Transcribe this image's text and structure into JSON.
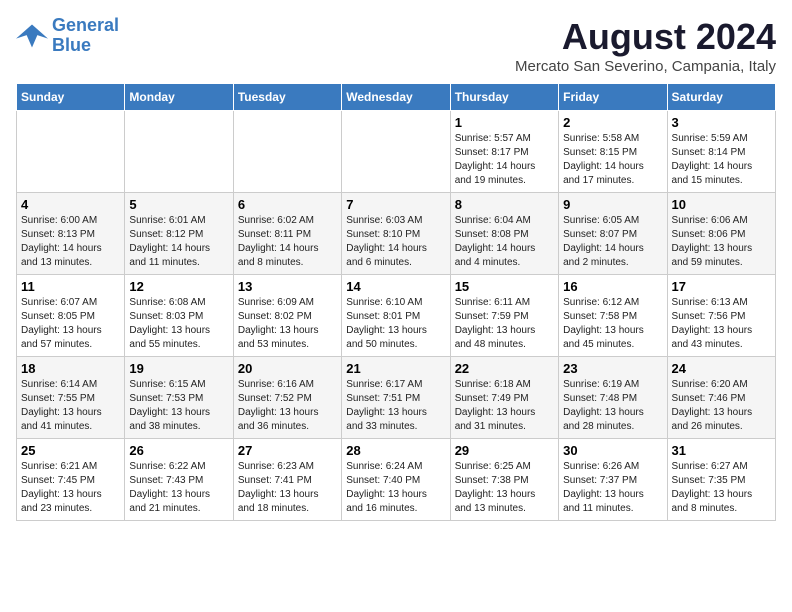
{
  "logo": {
    "line1": "General",
    "line2": "Blue"
  },
  "title": "August 2024",
  "subtitle": "Mercato San Severino, Campania, Italy",
  "weekdays": [
    "Sunday",
    "Monday",
    "Tuesday",
    "Wednesday",
    "Thursday",
    "Friday",
    "Saturday"
  ],
  "weeks": [
    [
      {
        "day": "",
        "info": ""
      },
      {
        "day": "",
        "info": ""
      },
      {
        "day": "",
        "info": ""
      },
      {
        "day": "",
        "info": ""
      },
      {
        "day": "1",
        "info": "Sunrise: 5:57 AM\nSunset: 8:17 PM\nDaylight: 14 hours\nand 19 minutes."
      },
      {
        "day": "2",
        "info": "Sunrise: 5:58 AM\nSunset: 8:15 PM\nDaylight: 14 hours\nand 17 minutes."
      },
      {
        "day": "3",
        "info": "Sunrise: 5:59 AM\nSunset: 8:14 PM\nDaylight: 14 hours\nand 15 minutes."
      }
    ],
    [
      {
        "day": "4",
        "info": "Sunrise: 6:00 AM\nSunset: 8:13 PM\nDaylight: 14 hours\nand 13 minutes."
      },
      {
        "day": "5",
        "info": "Sunrise: 6:01 AM\nSunset: 8:12 PM\nDaylight: 14 hours\nand 11 minutes."
      },
      {
        "day": "6",
        "info": "Sunrise: 6:02 AM\nSunset: 8:11 PM\nDaylight: 14 hours\nand 8 minutes."
      },
      {
        "day": "7",
        "info": "Sunrise: 6:03 AM\nSunset: 8:10 PM\nDaylight: 14 hours\nand 6 minutes."
      },
      {
        "day": "8",
        "info": "Sunrise: 6:04 AM\nSunset: 8:08 PM\nDaylight: 14 hours\nand 4 minutes."
      },
      {
        "day": "9",
        "info": "Sunrise: 6:05 AM\nSunset: 8:07 PM\nDaylight: 14 hours\nand 2 minutes."
      },
      {
        "day": "10",
        "info": "Sunrise: 6:06 AM\nSunset: 8:06 PM\nDaylight: 13 hours\nand 59 minutes."
      }
    ],
    [
      {
        "day": "11",
        "info": "Sunrise: 6:07 AM\nSunset: 8:05 PM\nDaylight: 13 hours\nand 57 minutes."
      },
      {
        "day": "12",
        "info": "Sunrise: 6:08 AM\nSunset: 8:03 PM\nDaylight: 13 hours\nand 55 minutes."
      },
      {
        "day": "13",
        "info": "Sunrise: 6:09 AM\nSunset: 8:02 PM\nDaylight: 13 hours\nand 53 minutes."
      },
      {
        "day": "14",
        "info": "Sunrise: 6:10 AM\nSunset: 8:01 PM\nDaylight: 13 hours\nand 50 minutes."
      },
      {
        "day": "15",
        "info": "Sunrise: 6:11 AM\nSunset: 7:59 PM\nDaylight: 13 hours\nand 48 minutes."
      },
      {
        "day": "16",
        "info": "Sunrise: 6:12 AM\nSunset: 7:58 PM\nDaylight: 13 hours\nand 45 minutes."
      },
      {
        "day": "17",
        "info": "Sunrise: 6:13 AM\nSunset: 7:56 PM\nDaylight: 13 hours\nand 43 minutes."
      }
    ],
    [
      {
        "day": "18",
        "info": "Sunrise: 6:14 AM\nSunset: 7:55 PM\nDaylight: 13 hours\nand 41 minutes."
      },
      {
        "day": "19",
        "info": "Sunrise: 6:15 AM\nSunset: 7:53 PM\nDaylight: 13 hours\nand 38 minutes."
      },
      {
        "day": "20",
        "info": "Sunrise: 6:16 AM\nSunset: 7:52 PM\nDaylight: 13 hours\nand 36 minutes."
      },
      {
        "day": "21",
        "info": "Sunrise: 6:17 AM\nSunset: 7:51 PM\nDaylight: 13 hours\nand 33 minutes."
      },
      {
        "day": "22",
        "info": "Sunrise: 6:18 AM\nSunset: 7:49 PM\nDaylight: 13 hours\nand 31 minutes."
      },
      {
        "day": "23",
        "info": "Sunrise: 6:19 AM\nSunset: 7:48 PM\nDaylight: 13 hours\nand 28 minutes."
      },
      {
        "day": "24",
        "info": "Sunrise: 6:20 AM\nSunset: 7:46 PM\nDaylight: 13 hours\nand 26 minutes."
      }
    ],
    [
      {
        "day": "25",
        "info": "Sunrise: 6:21 AM\nSunset: 7:45 PM\nDaylight: 13 hours\nand 23 minutes."
      },
      {
        "day": "26",
        "info": "Sunrise: 6:22 AM\nSunset: 7:43 PM\nDaylight: 13 hours\nand 21 minutes."
      },
      {
        "day": "27",
        "info": "Sunrise: 6:23 AM\nSunset: 7:41 PM\nDaylight: 13 hours\nand 18 minutes."
      },
      {
        "day": "28",
        "info": "Sunrise: 6:24 AM\nSunset: 7:40 PM\nDaylight: 13 hours\nand 16 minutes."
      },
      {
        "day": "29",
        "info": "Sunrise: 6:25 AM\nSunset: 7:38 PM\nDaylight: 13 hours\nand 13 minutes."
      },
      {
        "day": "30",
        "info": "Sunrise: 6:26 AM\nSunset: 7:37 PM\nDaylight: 13 hours\nand 11 minutes."
      },
      {
        "day": "31",
        "info": "Sunrise: 6:27 AM\nSunset: 7:35 PM\nDaylight: 13 hours\nand 8 minutes."
      }
    ]
  ]
}
